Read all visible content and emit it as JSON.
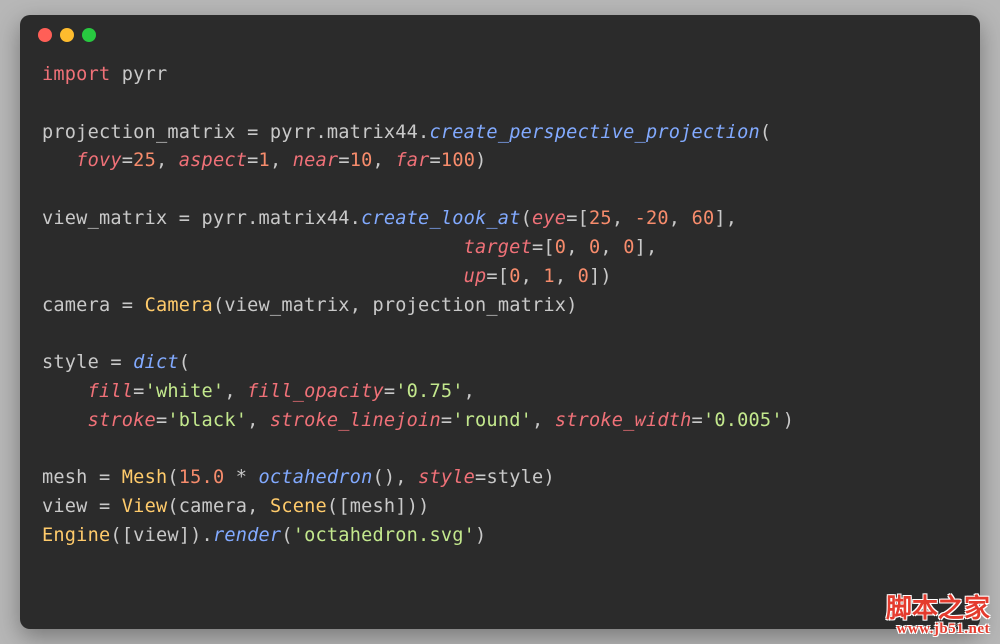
{
  "code": {
    "lines": [
      [
        [
          "kw",
          "import"
        ],
        [
          "sp",
          " "
        ],
        [
          "mod",
          "pyrr"
        ]
      ],
      [],
      [
        [
          "var",
          "projection_matrix "
        ],
        [
          "op",
          "= "
        ],
        [
          "var",
          "pyrr"
        ],
        [
          "punc",
          "."
        ],
        [
          "var",
          "matrix44"
        ],
        [
          "punc",
          "."
        ],
        [
          "fn",
          "create_perspective_projection"
        ],
        [
          "punc",
          "("
        ]
      ],
      [
        [
          "sp",
          "   "
        ],
        [
          "param",
          "fovy"
        ],
        [
          "op",
          "="
        ],
        [
          "num",
          "25"
        ],
        [
          "punc",
          ", "
        ],
        [
          "param",
          "aspect"
        ],
        [
          "op",
          "="
        ],
        [
          "num",
          "1"
        ],
        [
          "punc",
          ", "
        ],
        [
          "param",
          "near"
        ],
        [
          "op",
          "="
        ],
        [
          "num",
          "10"
        ],
        [
          "punc",
          ", "
        ],
        [
          "param",
          "far"
        ],
        [
          "op",
          "="
        ],
        [
          "num",
          "100"
        ],
        [
          "punc",
          ")"
        ]
      ],
      [],
      [
        [
          "var",
          "view_matrix "
        ],
        [
          "op",
          "= "
        ],
        [
          "var",
          "pyrr"
        ],
        [
          "punc",
          "."
        ],
        [
          "var",
          "matrix44"
        ],
        [
          "punc",
          "."
        ],
        [
          "fn",
          "create_look_at"
        ],
        [
          "punc",
          "("
        ],
        [
          "param",
          "eye"
        ],
        [
          "op",
          "="
        ],
        [
          "punc",
          "["
        ],
        [
          "num",
          "25"
        ],
        [
          "punc",
          ", "
        ],
        [
          "num",
          "-20"
        ],
        [
          "punc",
          ", "
        ],
        [
          "num",
          "60"
        ],
        [
          "punc",
          "],"
        ]
      ],
      [
        [
          "sp",
          "                                     "
        ],
        [
          "param",
          "target"
        ],
        [
          "op",
          "="
        ],
        [
          "punc",
          "["
        ],
        [
          "num",
          "0"
        ],
        [
          "punc",
          ", "
        ],
        [
          "num",
          "0"
        ],
        [
          "punc",
          ", "
        ],
        [
          "num",
          "0"
        ],
        [
          "punc",
          "],"
        ]
      ],
      [
        [
          "sp",
          "                                     "
        ],
        [
          "param",
          "up"
        ],
        [
          "op",
          "="
        ],
        [
          "punc",
          "["
        ],
        [
          "num",
          "0"
        ],
        [
          "punc",
          ", "
        ],
        [
          "num",
          "1"
        ],
        [
          "punc",
          ", "
        ],
        [
          "num",
          "0"
        ],
        [
          "punc",
          "])"
        ]
      ],
      [
        [
          "var",
          "camera "
        ],
        [
          "op",
          "= "
        ],
        [
          "class",
          "Camera"
        ],
        [
          "punc",
          "("
        ],
        [
          "var",
          "view_matrix"
        ],
        [
          "punc",
          ", "
        ],
        [
          "var",
          "projection_matrix"
        ],
        [
          "punc",
          ")"
        ]
      ],
      [],
      [
        [
          "var",
          "style "
        ],
        [
          "op",
          "= "
        ],
        [
          "dict",
          "dict"
        ],
        [
          "punc",
          "("
        ]
      ],
      [
        [
          "sp",
          "    "
        ],
        [
          "param",
          "fill"
        ],
        [
          "op",
          "="
        ],
        [
          "str",
          "'white'"
        ],
        [
          "punc",
          ", "
        ],
        [
          "param",
          "fill_opacity"
        ],
        [
          "op",
          "="
        ],
        [
          "str",
          "'0.75'"
        ],
        [
          "punc",
          ","
        ]
      ],
      [
        [
          "sp",
          "    "
        ],
        [
          "param",
          "stroke"
        ],
        [
          "op",
          "="
        ],
        [
          "str",
          "'black'"
        ],
        [
          "punc",
          ", "
        ],
        [
          "param",
          "stroke_linejoin"
        ],
        [
          "op",
          "="
        ],
        [
          "str",
          "'round'"
        ],
        [
          "punc",
          ", "
        ],
        [
          "param",
          "stroke_width"
        ],
        [
          "op",
          "="
        ],
        [
          "str",
          "'0.005'"
        ],
        [
          "punc",
          ")"
        ]
      ],
      [],
      [
        [
          "var",
          "mesh "
        ],
        [
          "op",
          "= "
        ],
        [
          "class",
          "Mesh"
        ],
        [
          "punc",
          "("
        ],
        [
          "num",
          "15.0"
        ],
        [
          "op",
          " * "
        ],
        [
          "fn",
          "octahedron"
        ],
        [
          "punc",
          "(), "
        ],
        [
          "param",
          "style"
        ],
        [
          "op",
          "="
        ],
        [
          "var",
          "style"
        ],
        [
          "punc",
          ")"
        ]
      ],
      [
        [
          "var",
          "view "
        ],
        [
          "op",
          "= "
        ],
        [
          "class",
          "View"
        ],
        [
          "punc",
          "("
        ],
        [
          "var",
          "camera"
        ],
        [
          "punc",
          ", "
        ],
        [
          "class",
          "Scene"
        ],
        [
          "punc",
          "(["
        ],
        [
          "var",
          "mesh"
        ],
        [
          "punc",
          "]))"
        ]
      ],
      [
        [
          "class",
          "Engine"
        ],
        [
          "punc",
          "(["
        ],
        [
          "var",
          "view"
        ],
        [
          "punc",
          "])."
        ],
        [
          "fn",
          "render"
        ],
        [
          "punc",
          "("
        ],
        [
          "str",
          "'octahedron.svg'"
        ],
        [
          "punc",
          ")"
        ]
      ]
    ]
  },
  "watermark": {
    "title": "脚本之家",
    "url": "www.jb51.net"
  }
}
